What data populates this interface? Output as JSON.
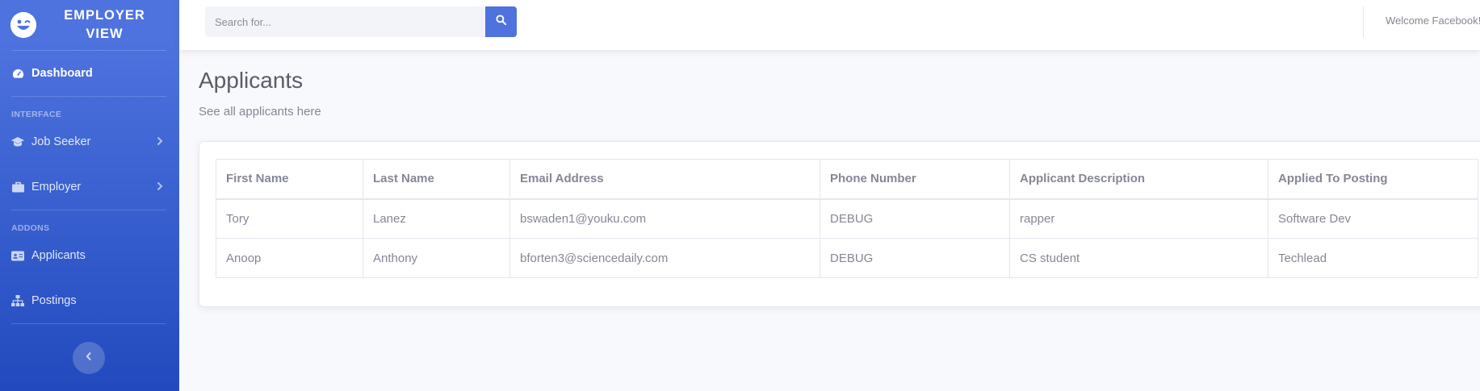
{
  "brand": {
    "title": "EMPLOYER VIEW"
  },
  "sidebar": {
    "dashboard": "Dashboard",
    "heading_interface": "INTERFACE",
    "job_seeker": "Job Seeker",
    "employer": "Employer",
    "heading_addons": "ADDONS",
    "applicants": "Applicants",
    "postings": "Postings"
  },
  "topbar": {
    "search_placeholder": "Search for...",
    "welcome": "Welcome Facebook!"
  },
  "page": {
    "title": "Applicants",
    "subtitle": "See all applicants here"
  },
  "table": {
    "headers": [
      "First Name",
      "Last Name",
      "Email Address",
      "Phone Number",
      "Applicant Description",
      "Applied To Posting"
    ],
    "rows": [
      [
        "Tory",
        "Lanez",
        "bswaden1@youku.com",
        "DEBUG",
        "rapper",
        "Software Dev"
      ],
      [
        "Anoop",
        "Anthony",
        "bforten3@sciencedaily.com",
        "DEBUG",
        "CS student",
        "Techlead"
      ]
    ]
  },
  "colors": {
    "primary": "#4e73df",
    "primary_dark": "#224abe",
    "text": "#858796",
    "title": "#5a5c69"
  },
  "icons": [
    "laugh-wink-icon",
    "tachometer-icon",
    "graduation-cap-icon",
    "briefcase-icon",
    "id-card-icon",
    "sitemap-icon",
    "chevron-right-icon",
    "chevron-left-icon",
    "search-icon"
  ]
}
